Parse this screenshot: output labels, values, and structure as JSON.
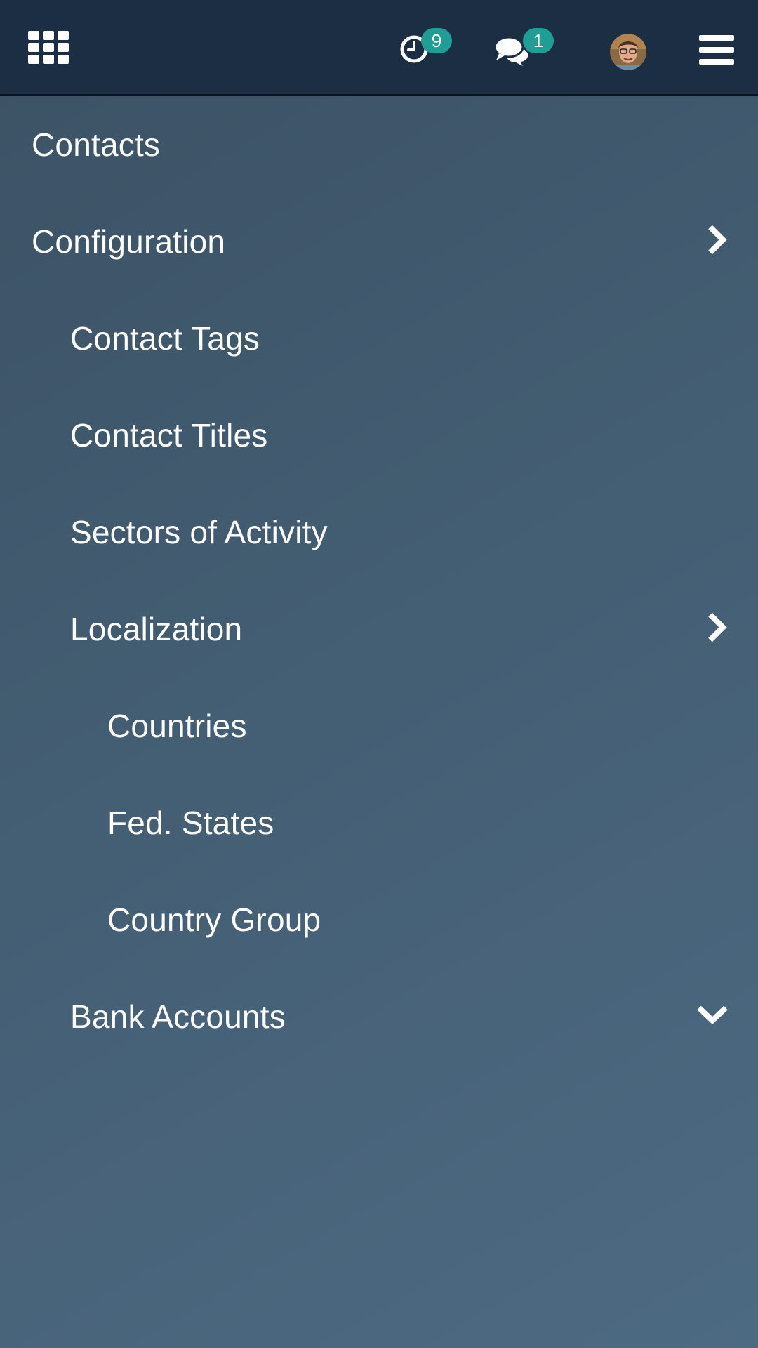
{
  "header": {
    "apps_icon": "grid-icon",
    "activity": {
      "icon": "clock-icon",
      "count": "9"
    },
    "messages": {
      "icon": "chat-icon",
      "count": "1"
    },
    "avatar": "user-avatar",
    "menu_icon": "hamburger-icon"
  },
  "colors": {
    "topbar": "#1c2e43",
    "badge": "#1f9e95",
    "background_start": "#3c5164",
    "background_end": "#4d6a83",
    "text": "#ffffff"
  },
  "menu": {
    "items": [
      {
        "label": "Contacts",
        "level": 0
      },
      {
        "label": "Configuration",
        "level": 0,
        "icon": "chevron-right-icon"
      },
      {
        "label": "Contact Tags",
        "level": 1
      },
      {
        "label": "Contact Titles",
        "level": 1
      },
      {
        "label": "Sectors of Activity",
        "level": 1
      },
      {
        "label": "Localization",
        "level": 1,
        "icon": "chevron-right-icon"
      },
      {
        "label": "Countries",
        "level": 2
      },
      {
        "label": "Fed. States",
        "level": 2
      },
      {
        "label": "Country Group",
        "level": 2
      },
      {
        "label": "Bank Accounts",
        "level": 1,
        "icon": "chevron-down-icon"
      }
    ]
  }
}
